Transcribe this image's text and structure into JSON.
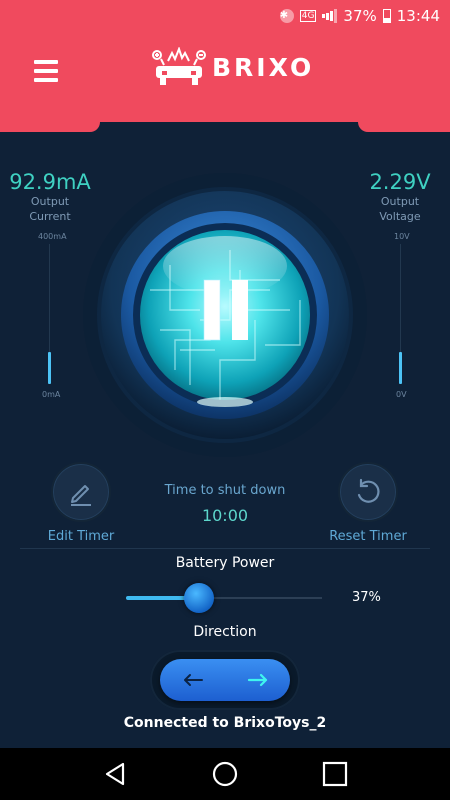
{
  "status_bar": {
    "network": "4G",
    "battery": "37%",
    "time": "13:44",
    "icons": [
      "bluetooth-icon",
      "network-4g-icon",
      "signal-icon",
      "battery-icon"
    ]
  },
  "header": {
    "logo_text": "BRIXO",
    "menu_icon": "hamburger-menu-icon",
    "color": "#f04a5e"
  },
  "output_current": {
    "value": "92.9mA",
    "label_line1": "Output",
    "label_line2": "Current",
    "max_label": "400mA",
    "min_label": "0mA",
    "level": 0.232
  },
  "output_voltage": {
    "value": "2.29V",
    "label_line1": "Output",
    "label_line2": "Voltage",
    "max_label": "10V",
    "min_label": "0V",
    "level": 0.229
  },
  "power_button": {
    "state": "paused",
    "icon": "pause-icon"
  },
  "timer": {
    "title": "Time to shut down",
    "value": "10:00",
    "edit_label": "Edit Timer",
    "reset_label": "Reset Timer",
    "edit_icon": "pencil-icon",
    "reset_icon": "reset-icon"
  },
  "battery_power": {
    "title": "Battery Power",
    "percent_label": "37%",
    "level": 0.37
  },
  "direction": {
    "title": "Direction",
    "left_icon": "arrow-left-icon",
    "right_icon": "arrow-right-icon",
    "selected": "right"
  },
  "connection": {
    "status": "Connected to BrixoToys_2"
  },
  "nav_bar": {
    "icons": [
      "back-icon",
      "home-icon",
      "recents-icon"
    ]
  },
  "colors": {
    "accent_teal": "#3fd1c2",
    "accent_blue": "#3fbaf0",
    "background": "#0f2137",
    "header_red": "#f04a5e"
  }
}
